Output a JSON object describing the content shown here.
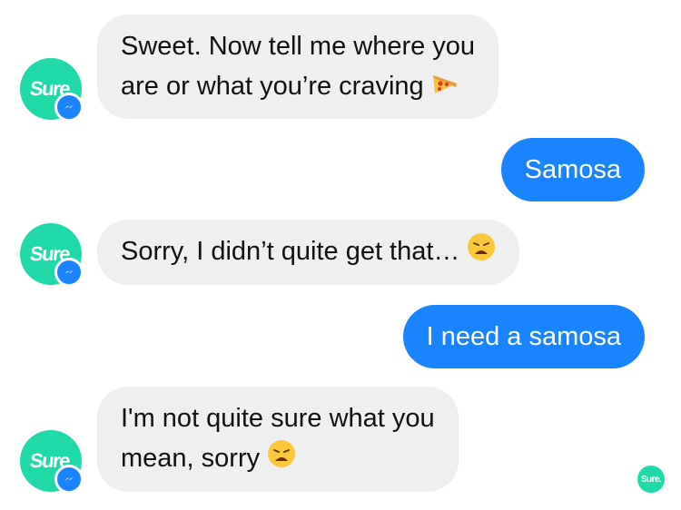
{
  "bot": {
    "name": "Sure",
    "brand_color": "#20d9a9",
    "platform_badge": "messenger-icon"
  },
  "messages": [
    {
      "sender": "bot",
      "lines": [
        "Sweet. Now tell me where you",
        "are or what you’re craving"
      ],
      "emoji": "pizza-icon"
    },
    {
      "sender": "user",
      "text": "Samosa"
    },
    {
      "sender": "bot",
      "lines": [
        "Sorry, I didn’t quite get that…"
      ],
      "emoji": "weary-face-icon"
    },
    {
      "sender": "user",
      "text": "I need a samosa"
    },
    {
      "sender": "bot",
      "lines": [
        "I'm not quite sure what you",
        "mean, sorry"
      ],
      "emoji": "weary-face-icon"
    }
  ],
  "seen_indicator": {
    "label": "Sure."
  },
  "colors": {
    "incoming_bubble": "#efefef",
    "outgoing_bubble": "#1a84ff",
    "messenger_badge": "#1a84ff"
  }
}
